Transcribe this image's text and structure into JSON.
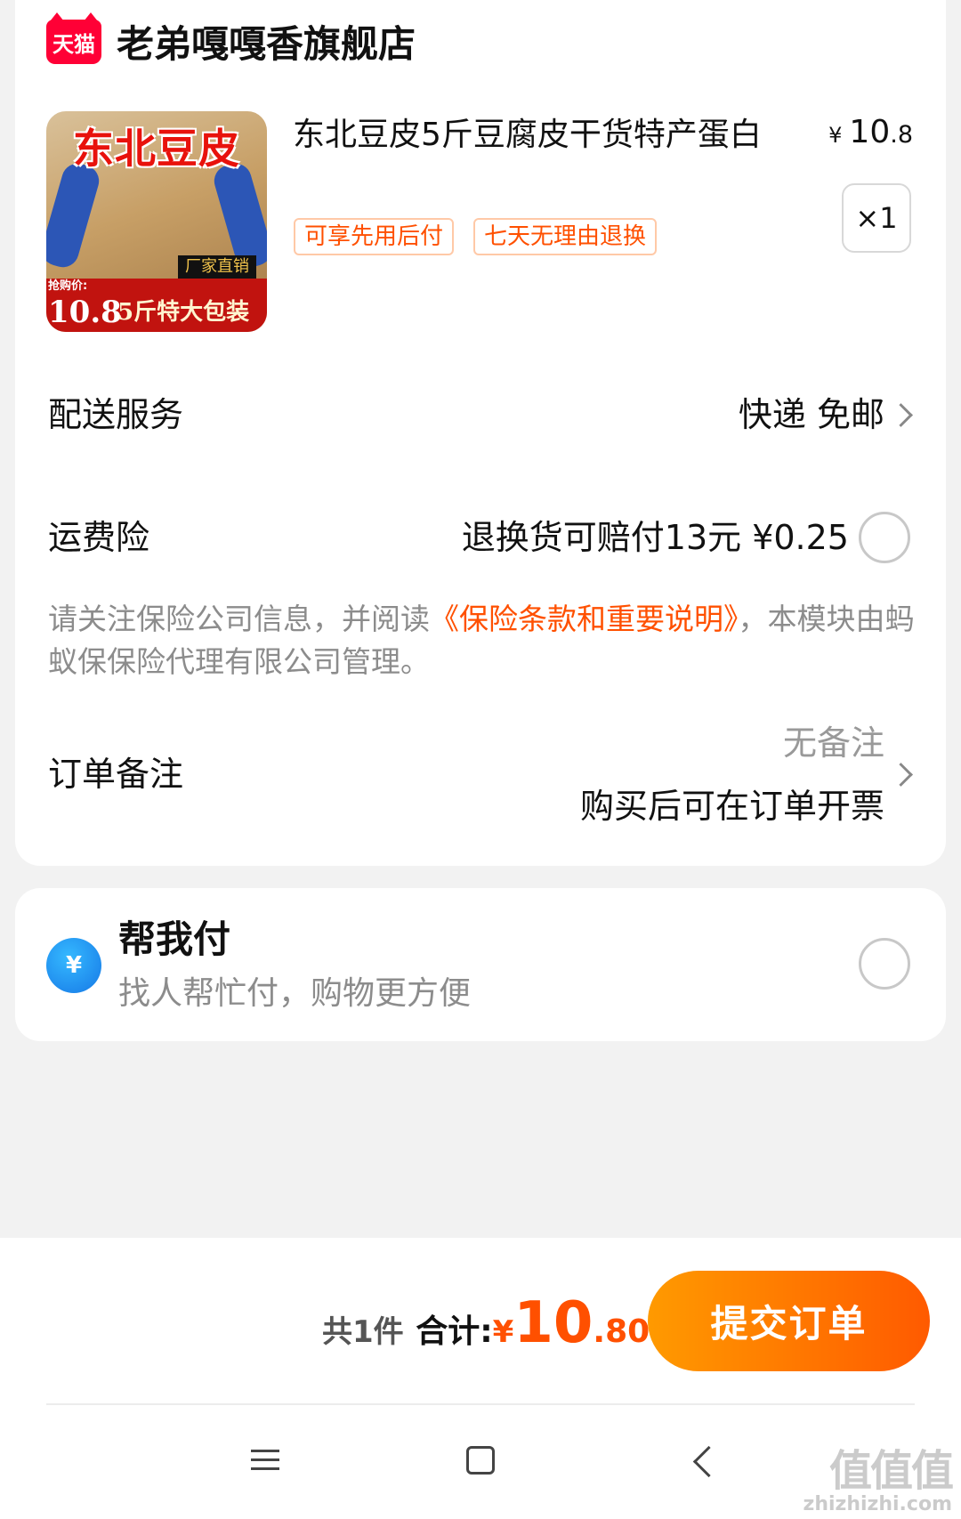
{
  "store": {
    "badge": "天猫",
    "name": "老弟嘎嘎香旗舰店"
  },
  "product": {
    "image_title": "东北豆皮",
    "image_sub": "厂家直销",
    "image_sticker_label": "抢购价:",
    "image_sticker_price": "10.8",
    "image_pack": "5斤特大包装",
    "title": "东北豆皮5斤豆腐皮干货特产蛋白",
    "price_symbol": "¥",
    "price_int": "10",
    "price_dec": ".8",
    "quantity": "×1",
    "tags": [
      "可享先用后付",
      "七天无理由退换"
    ]
  },
  "delivery": {
    "label": "配送服务",
    "value": "快递 免邮"
  },
  "insurance": {
    "label": "运费险",
    "value": "退换货可赔付13元 ¥0.25",
    "selected": false
  },
  "notice": {
    "prefix": "请关注保险公司信息，并阅读",
    "link": "《保险条款和重要说明》",
    "suffix": "，本模块由蚂蚁保保险代理有限公司管理。"
  },
  "remark": {
    "label": "订单备注",
    "value": "无备注",
    "invoice": "购买后可在订单开票"
  },
  "help_pay": {
    "icon": "¥",
    "title": "帮我付",
    "subtitle": "找人帮忙付，购物更方便",
    "selected": false
  },
  "footer": {
    "count": "共1件",
    "total_label": "合计:",
    "currency": "¥",
    "total_int": "10",
    "total_dec": ".80",
    "submit": "提交订单"
  },
  "watermark": {
    "brand": "值值值",
    "domain": "zhizhizhi.com"
  },
  "colors": {
    "accent": "#ff5000",
    "brand": "#ff0036",
    "help_icon": "#1678e6"
  },
  "icons": [
    "tmall-logo",
    "chevron-right-icon",
    "radio-icon",
    "help-pay-icon",
    "menu-icon",
    "home-icon",
    "back-icon"
  ]
}
